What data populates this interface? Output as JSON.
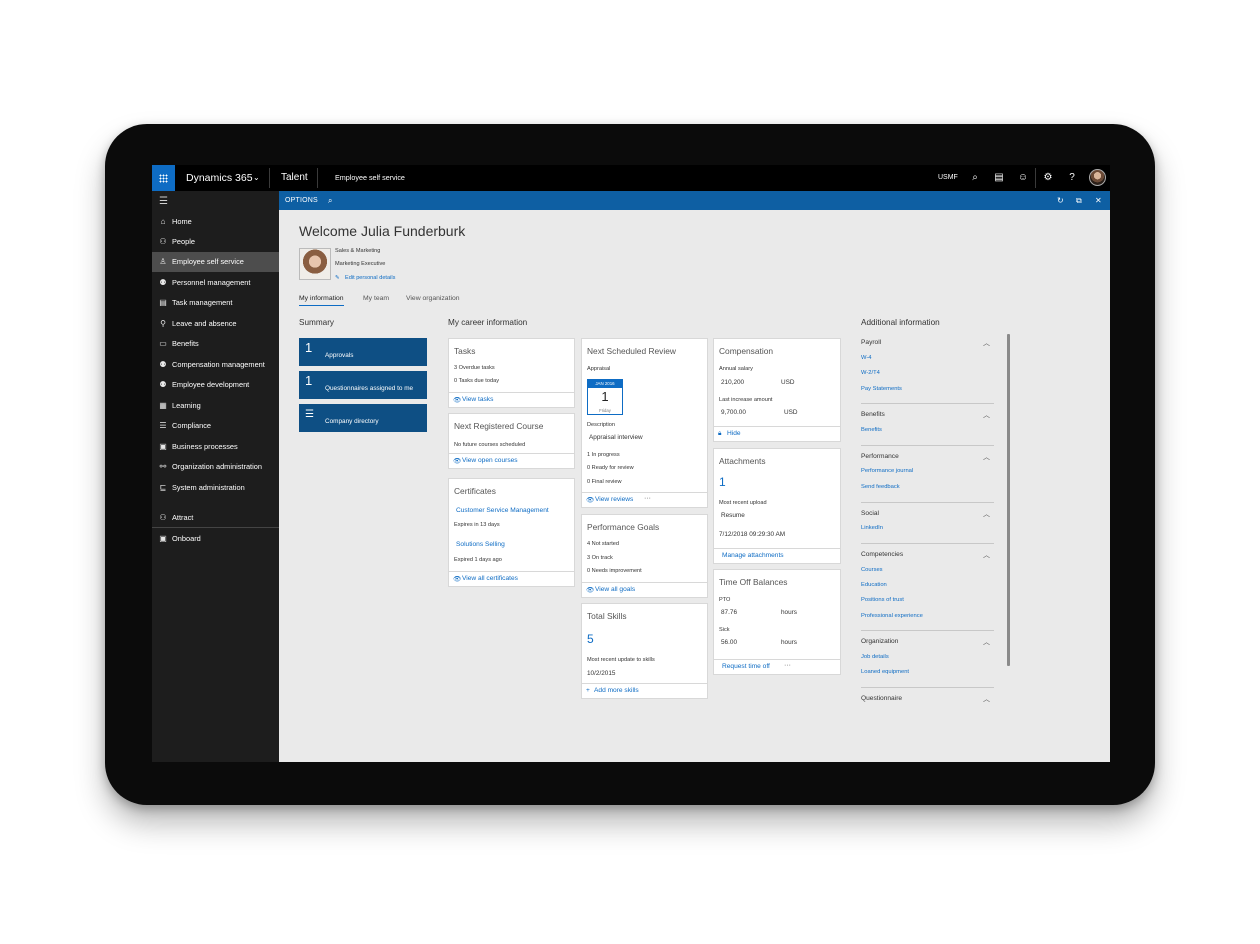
{
  "topbar": {
    "app_name": "Dynamics 365",
    "module": "Talent",
    "page": "Employee self service",
    "company": "USMF",
    "icons": [
      "waffle-icon",
      "chevron-down-icon",
      "search-icon",
      "chat-icon",
      "smiley-icon",
      "gear-icon",
      "help-icon",
      "user-avatar"
    ]
  },
  "sidebar": {
    "items": [
      {
        "label": "Home",
        "icon": "home-icon"
      },
      {
        "label": "People",
        "icon": "people-icon"
      },
      {
        "label": "Employee self service",
        "icon": "self-service-icon",
        "active": true
      },
      {
        "label": "Personnel management",
        "icon": "personnel-icon"
      },
      {
        "label": "Task management",
        "icon": "task-icon"
      },
      {
        "label": "Leave and absence",
        "icon": "leave-icon"
      },
      {
        "label": "Benefits",
        "icon": "benefits-icon"
      },
      {
        "label": "Compensation management",
        "icon": "compensation-icon"
      },
      {
        "label": "Employee development",
        "icon": "development-icon"
      },
      {
        "label": "Learning",
        "icon": "learning-icon"
      },
      {
        "label": "Compliance",
        "icon": "compliance-icon"
      },
      {
        "label": "Business processes",
        "icon": "business-icon"
      },
      {
        "label": "Organization administration",
        "icon": "org-icon"
      },
      {
        "label": "System administration",
        "icon": "system-icon"
      }
    ],
    "extra": [
      {
        "label": "Attract",
        "icon": "attract-icon"
      },
      {
        "label": "Onboard",
        "icon": "onboard-icon"
      }
    ]
  },
  "options_bar": {
    "label": "OPTIONS"
  },
  "header": {
    "welcome": "Welcome Julia Funderburk",
    "department": "Sales & Marketing",
    "title": "Marketing Executive",
    "edit_link": "Edit personal details"
  },
  "tabs": [
    "My information",
    "My team",
    "View organization"
  ],
  "summary": {
    "heading": "Summary",
    "tiles": [
      {
        "count": "1",
        "label": "Approvals"
      },
      {
        "count": "1",
        "label": "Questionnaires assigned to me"
      },
      {
        "count": "",
        "label": "Company directory"
      }
    ]
  },
  "career": {
    "heading": "My career information",
    "tasks": {
      "title": "Tasks",
      "lines": [
        "3 Overdue tasks",
        "0 Tasks due today"
      ],
      "footer": "View tasks"
    },
    "course": {
      "title": "Next Registered Course",
      "line": "No future courses scheduled",
      "footer": "View open courses"
    },
    "certificates": {
      "title": "Certificates",
      "items": [
        {
          "name": "Customer Service Management",
          "status": "Expires in 13 days"
        },
        {
          "name": "Solutions Selling",
          "status": "Expired 1 days ago"
        }
      ],
      "footer": "View all certificates"
    },
    "review": {
      "title": "Next Scheduled Review",
      "link": "Appraisal",
      "cal_month": "JAN 2016",
      "cal_day": "1",
      "cal_weekday": "Friday",
      "desc_label": "Description",
      "desc_value": "Appraisal interview",
      "stats": [
        "1 In progress",
        "0 Ready for review",
        "0 Final review"
      ],
      "footer": "View reviews",
      "more": "···"
    },
    "goals": {
      "title": "Performance Goals",
      "lines": [
        "4 Not started",
        "3 On track",
        "0 Needs improvement"
      ],
      "footer": "View all goals"
    },
    "skills": {
      "title": "Total Skills",
      "count": "5",
      "label": "Most recent update to skills",
      "date": "10/2/2015",
      "footer": "Add more skills"
    },
    "compensation": {
      "title": "Compensation",
      "salary_label": "Annual salary",
      "salary": "210,200",
      "salary_cur": "USD",
      "inc_label": "Last increase amount",
      "increase": "9,700.00",
      "inc_cur": "USD",
      "footer": "Hide"
    },
    "attachments": {
      "title": "Attachments",
      "count": "1",
      "label": "Most recent upload",
      "name": "Resume",
      "date": "7/12/2018 09:29:30 AM",
      "footer": "Manage attachments"
    },
    "timeoff": {
      "title": "Time Off Balances",
      "rows": [
        {
          "type": "PTO",
          "value": "87.76",
          "unit": "hours"
        },
        {
          "type": "Sick",
          "value": "56.00",
          "unit": "hours"
        }
      ],
      "footer": "Request time off",
      "more": "···"
    }
  },
  "additional": {
    "heading": "Additional information",
    "sections": [
      {
        "title": "Payroll",
        "links": [
          "W-4",
          "W-2/T4",
          "Pay Statements"
        ]
      },
      {
        "title": "Benefits",
        "links": [
          "Benefits"
        ]
      },
      {
        "title": "Performance",
        "links": [
          "Performance journal",
          "Send feedback"
        ]
      },
      {
        "title": "Social",
        "links": [
          "LinkedIn"
        ]
      },
      {
        "title": "Competencies",
        "links": [
          "Courses",
          "Education",
          "Positions of trust",
          "Professional experience"
        ]
      },
      {
        "title": "Organization",
        "links": [
          "Job details",
          "Loaned equipment"
        ]
      },
      {
        "title": "Questionnaire",
        "links": []
      }
    ]
  }
}
